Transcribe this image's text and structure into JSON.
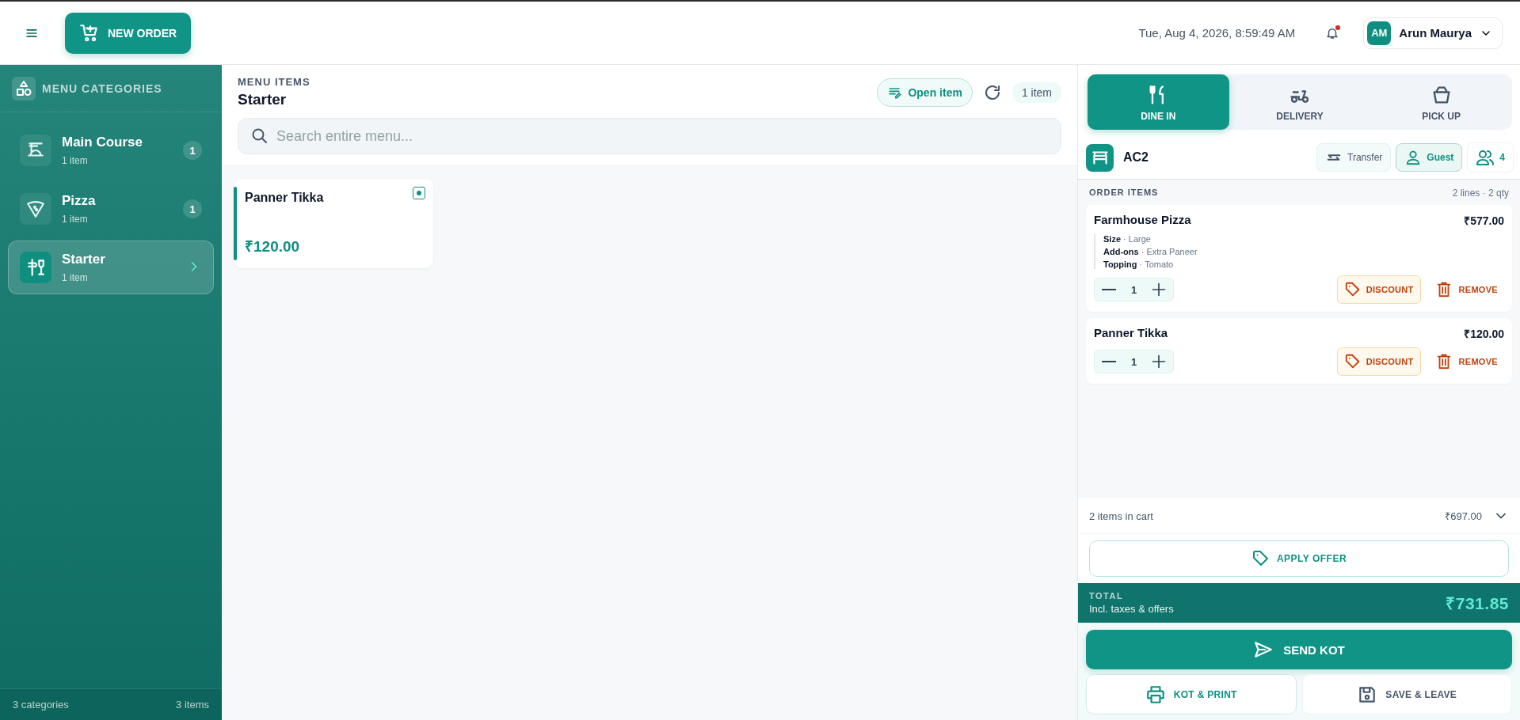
{
  "topbar": {
    "new_order_label": "NEW ORDER",
    "datetime": "Tue, Aug 4, 2026, 8:59:49 AM",
    "notification_unread": true,
    "user": {
      "initials": "AM",
      "name": "Arun Maurya"
    }
  },
  "sidebar": {
    "title": "MENU CATEGORIES",
    "categories": [
      {
        "name": "Main Course",
        "count_label": "1 item",
        "badge": "1",
        "selected": false
      },
      {
        "name": "Pizza",
        "count_label": "1 item",
        "badge": "1",
        "selected": false
      },
      {
        "name": "Starter",
        "count_label": "1 item",
        "selected": true
      }
    ],
    "footer": {
      "categories": "3 categories",
      "items": "3 items"
    }
  },
  "menu": {
    "label": "MENU ITEMS",
    "category": "Starter",
    "open_item_label": "Open item",
    "count_label": "1 item",
    "search_placeholder": "Search entire menu...",
    "items": [
      {
        "name": "Panner Tikka",
        "price": "₹120.00",
        "veg": true
      }
    ]
  },
  "order": {
    "modes": [
      {
        "label": "DINE IN",
        "selected": true
      },
      {
        "label": "DELIVERY",
        "selected": false
      },
      {
        "label": "PICK UP",
        "selected": false
      }
    ],
    "table": {
      "name": "AC2",
      "transfer_label": "Transfer",
      "guest_label": "Guest",
      "guests": "4"
    },
    "items_heading": "ORDER ITEMS",
    "items_summary": "2 lines · 2 qty",
    "items": [
      {
        "name": "Farmhouse Pizza",
        "price": "₹577.00",
        "modifiers": [
          "**Size** · Large",
          "**Add-ons** · Extra Paneer",
          "**Topping** · Tomato"
        ],
        "qty": "1",
        "discount_label": "DISCOUNT",
        "remove_label": "REMOVE"
      },
      {
        "name": "Panner Tikka",
        "price": "₹120.00",
        "qty": "1",
        "discount_label": "DISCOUNT",
        "remove_label": "REMOVE"
      }
    ],
    "cart_summary": "2 items in cart",
    "cart_subtotal": "₹697.00",
    "apply_offer_label": "APPLY OFFER",
    "total": {
      "label": "TOTAL",
      "note": "Incl. taxes & offers",
      "amount": "₹731.85"
    },
    "send_kot_label": "SEND KOT",
    "kot_print_label": "KOT & PRINT",
    "save_leave_label": "SAVE & LEAVE"
  }
}
